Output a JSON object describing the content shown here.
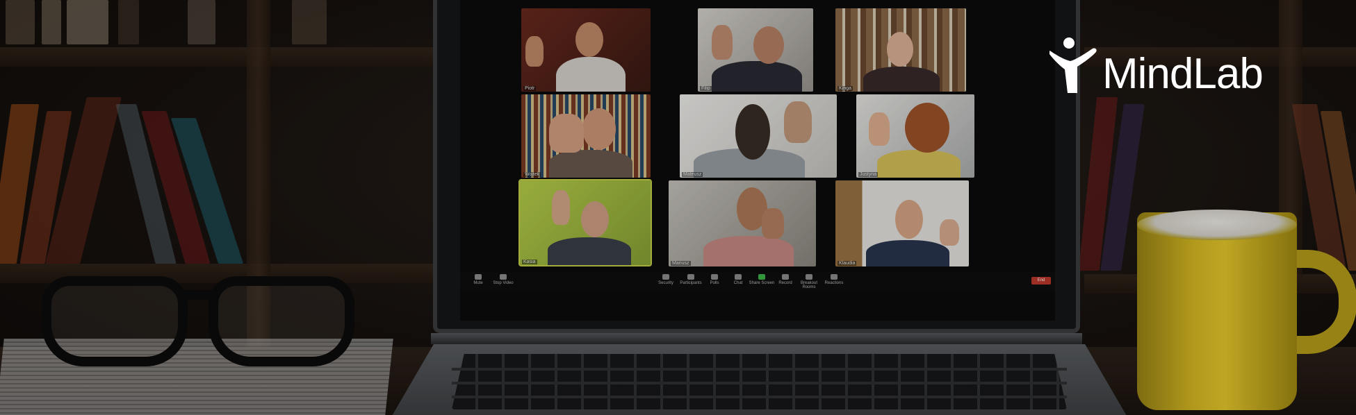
{
  "brand": {
    "name": "MindLab",
    "icon": "person-raising-arms-logo-icon",
    "color": "#ffffff"
  },
  "meeting": {
    "participants": [
      {
        "name": "Piotr"
      },
      {
        "name": "Filip"
      },
      {
        "name": "Kinga"
      },
      {
        "name": "Wojtek"
      },
      {
        "name": "Mateusz"
      },
      {
        "name": "Justyna"
      },
      {
        "name": "Kasia"
      },
      {
        "name": "Mariusz"
      },
      {
        "name": "Klaudia"
      }
    ],
    "toolbar": {
      "mute": "Mute",
      "stop_video": "Stop Video",
      "security": "Security",
      "participants": "Participants",
      "polls": "Polls",
      "chat": "Chat",
      "share_screen": "Share Screen",
      "record": "Record",
      "breakout_rooms": "Breakout Rooms",
      "reactions": "Reactions",
      "end": "End"
    }
  },
  "colors": {
    "mug": "#e0c22a",
    "share_screen": "#3cb64a",
    "end_button": "#c0392b",
    "active_speaker_border": "#c9d24a"
  }
}
